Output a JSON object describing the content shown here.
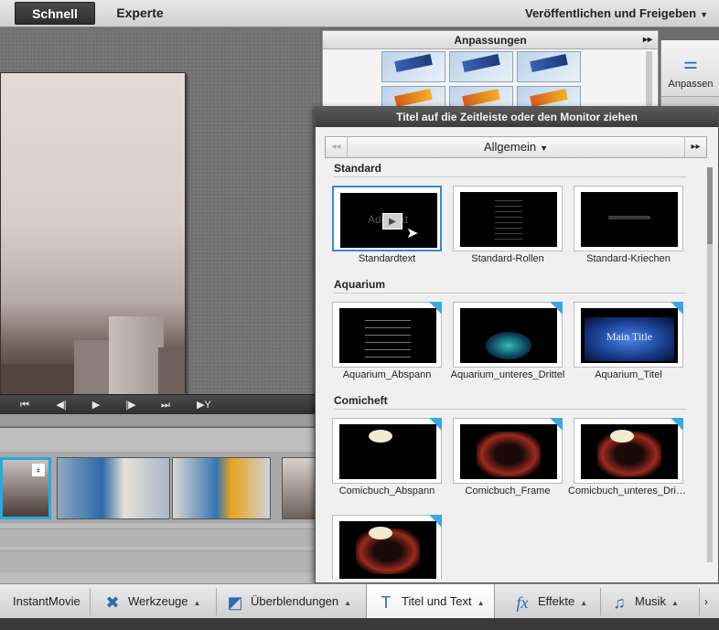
{
  "topbar": {
    "tab_quick": "Schnell",
    "tab_expert": "Experte",
    "publish_menu": "Veröffentlichen und Freigeben"
  },
  "adjustments": {
    "title": "Anpassungen",
    "tool_label": "Anpassen"
  },
  "titles_panel": {
    "header": "Titel auf die Zeitleiste oder den Monitor ziehen",
    "category": "Allgemein",
    "groups": [
      {
        "name": "Standard",
        "items": [
          "Standardtext",
          "Standard-Rollen",
          "Standard-Kriechen"
        ]
      },
      {
        "name": "Aquarium",
        "items": [
          "Aquarium_Abspann",
          "Aquarium_unteres_Drittel",
          "Aquarium_Titel"
        ]
      },
      {
        "name": "Comicheft",
        "items": [
          "Comicbuch_Abspann",
          "Comicbuch_Frame",
          "Comicbuch_unteres_Dritt..."
        ]
      }
    ],
    "thumb_text_standard": "Add text",
    "thumb_text_main_title": "Main Title"
  },
  "bottombar": {
    "instant_movie": "InstantMovie",
    "tools": "Werkzeuge",
    "transitions": "Überblendungen",
    "titles_text": "Titel und Text",
    "effects": "Effekte",
    "music": "Musik"
  },
  "colors": {
    "accent_blue": "#3d85d6",
    "selection_cyan": "#27a9e1",
    "panel_header_dark": "#3c3c3c"
  },
  "icons": {
    "adjust": "sliders-icon",
    "tools": "wrench-icon",
    "transitions": "transition-icon",
    "titles": "text-t-icon",
    "effects": "fx-icon",
    "music": "music-note-icon"
  }
}
